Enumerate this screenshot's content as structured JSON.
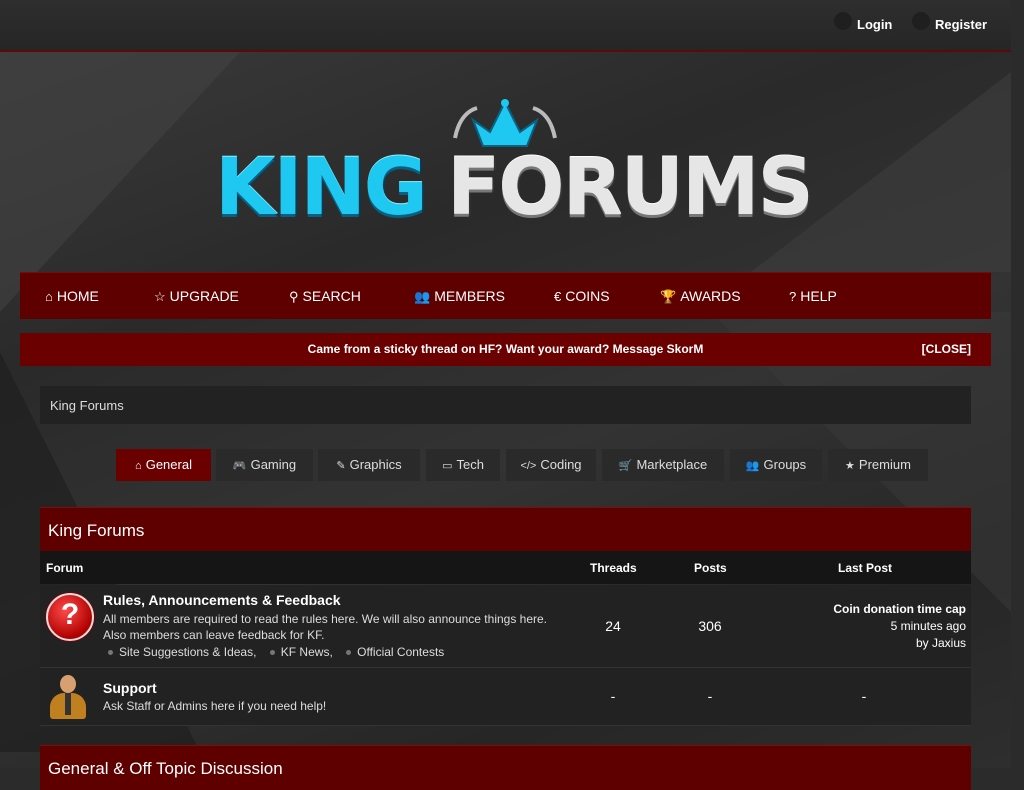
{
  "topbar": {
    "login": "Login",
    "register": "Register"
  },
  "logo": {
    "part1": "KING",
    "part2": "FORUMS"
  },
  "mainnav": [
    {
      "icon": "home-icon",
      "glyph": "⌂",
      "label": "HOME"
    },
    {
      "icon": "star-icon",
      "glyph": "☆",
      "label": "UPGRADE"
    },
    {
      "icon": "search-icon",
      "glyph": "⚲",
      "label": "SEARCH"
    },
    {
      "icon": "users-icon",
      "glyph": "👥",
      "label": "MEMBERS"
    },
    {
      "icon": "euro-icon",
      "glyph": "€",
      "label": "COINS"
    },
    {
      "icon": "trophy-icon",
      "glyph": "🏆",
      "label": "AWARDS"
    },
    {
      "icon": "question-icon",
      "glyph": "?",
      "label": "HELP"
    }
  ],
  "notice": {
    "text": "Came from a sticky thread on HF? Want your award? Message SkorM",
    "close": "[CLOSE]"
  },
  "breadcrumb": {
    "label": "King Forums"
  },
  "category_tabs": [
    {
      "icon": "home-icon",
      "glyph": "⌂",
      "label": "General",
      "active": true
    },
    {
      "icon": "gamepad-icon",
      "glyph": "🎮",
      "label": "Gaming"
    },
    {
      "icon": "brush-icon",
      "glyph": "✎",
      "label": "Graphics"
    },
    {
      "icon": "monitor-icon",
      "glyph": "▭",
      "label": "Tech"
    },
    {
      "icon": "code-icon",
      "glyph": "</>",
      "label": "Coding"
    },
    {
      "icon": "cart-icon",
      "glyph": "🛒",
      "label": "Marketplace"
    },
    {
      "icon": "users-icon",
      "glyph": "👥",
      "label": "Groups"
    },
    {
      "icon": "star-icon",
      "glyph": "★",
      "label": "Premium"
    }
  ],
  "section1": {
    "title": "King Forums",
    "columns": {
      "forum": "Forum",
      "threads": "Threads",
      "posts": "Posts",
      "last_post": "Last Post"
    },
    "forums": [
      {
        "icon": "help-icon",
        "title": "Rules, Announcements & Feedback",
        "desc_line1": "All members are required to read the rules here. We will also announce things here.",
        "desc_line2": "Also members can leave feedback for KF.",
        "subforums": [
          "Site Suggestions & Ideas,",
          "KF News,",
          "Official Contests"
        ],
        "threads": "24",
        "posts": "306",
        "last_post": {
          "title": "Coin donation time cap",
          "time": "5 minutes ago",
          "by": "by Jaxius"
        }
      },
      {
        "icon": "support-person-icon",
        "title": "Support",
        "desc_line1": "Ask Staff or Admins here if you need help!",
        "threads": "-",
        "posts": "-",
        "last_post": {
          "title": "-"
        }
      }
    ]
  },
  "section2": {
    "title": "General & Off Topic Discussion"
  },
  "colors": {
    "accent": "#5e0000",
    "notice": "#6b0000",
    "logo_blue": "#1ec8f0"
  }
}
